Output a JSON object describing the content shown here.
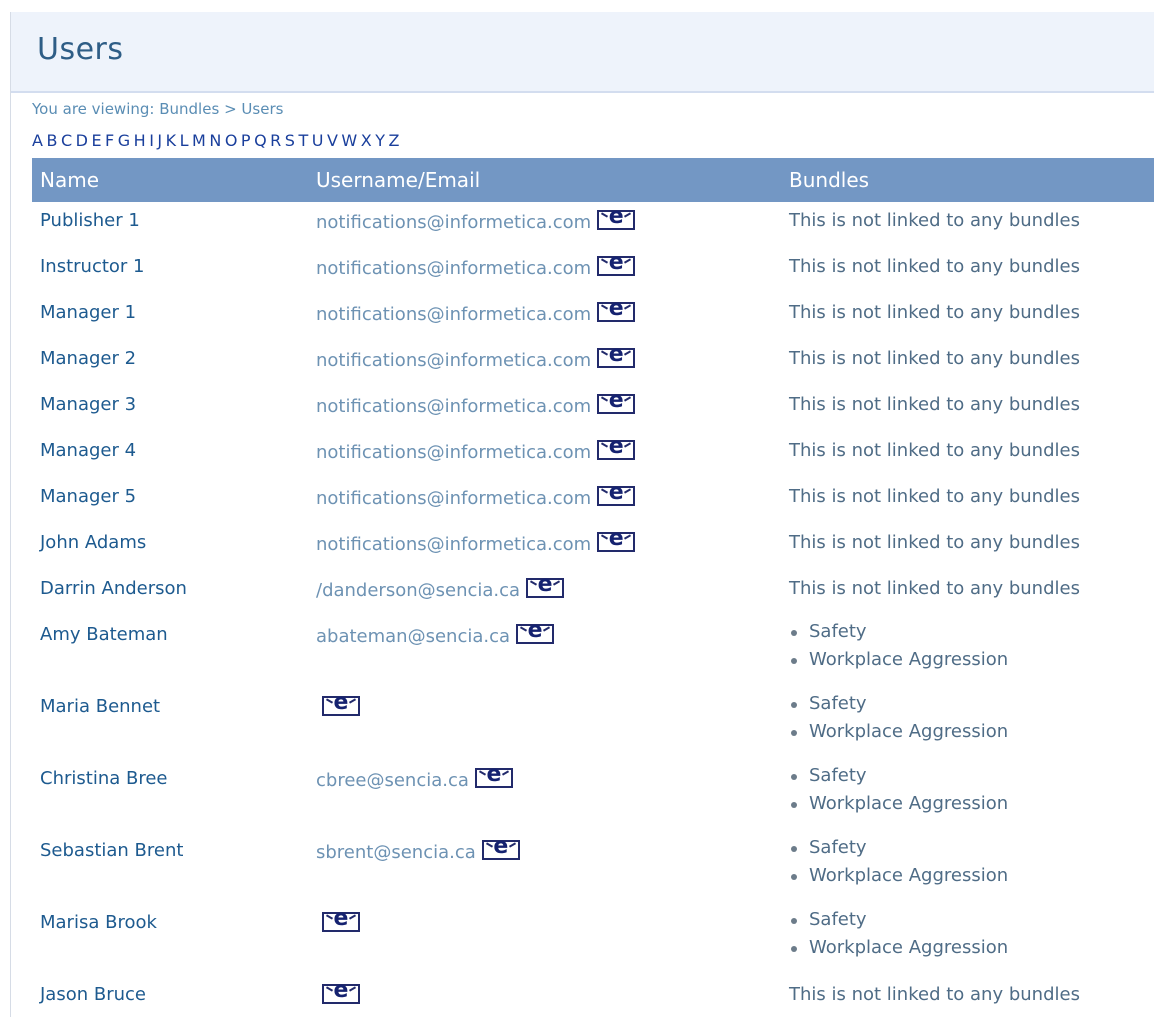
{
  "header": {
    "title": "Users"
  },
  "breadcrumb": {
    "prefix": "You are viewing:",
    "items": [
      "Bundles",
      "Users"
    ],
    "separator": ">"
  },
  "alphabet": [
    "A",
    "B",
    "C",
    "D",
    "E",
    "F",
    "G",
    "H",
    "I",
    "J",
    "K",
    "L",
    "M",
    "N",
    "O",
    "P",
    "Q",
    "R",
    "S",
    "T",
    "U",
    "V",
    "W",
    "X",
    "Y",
    "Z"
  ],
  "table": {
    "columns": [
      "Name",
      "Username/Email",
      "Bundles"
    ],
    "email_icon_glyph": "e",
    "rows": [
      {
        "name": "Publisher 1",
        "email": "notifications@informetica.com",
        "bundles_text": "This is not linked to any bundles"
      },
      {
        "name": "Instructor 1",
        "email": "notifications@informetica.com",
        "bundles_text": "This is not linked to any bundles"
      },
      {
        "name": "Manager 1",
        "email": "notifications@informetica.com",
        "bundles_text": "This is not linked to any bundles"
      },
      {
        "name": "Manager 2",
        "email": "notifications@informetica.com",
        "bundles_text": "This is not linked to any bundles"
      },
      {
        "name": "Manager 3",
        "email": "notifications@informetica.com",
        "bundles_text": "This is not linked to any bundles"
      },
      {
        "name": "Manager 4",
        "email": "notifications@informetica.com",
        "bundles_text": "This is not linked to any bundles"
      },
      {
        "name": "Manager 5",
        "email": "notifications@informetica.com",
        "bundles_text": "This is not linked to any bundles"
      },
      {
        "name": "John Adams",
        "email": "notifications@informetica.com",
        "bundles_text": "This is not linked to any bundles"
      },
      {
        "name": "Darrin Anderson",
        "email": "/danderson@sencia.ca",
        "bundles_text": "This is not linked to any bundles"
      },
      {
        "name": "Amy Bateman",
        "email": "abateman@sencia.ca",
        "bundles": [
          "Safety",
          "Workplace Aggression"
        ]
      },
      {
        "name": "Maria Bennet",
        "email": "",
        "bundles": [
          "Safety",
          "Workplace Aggression"
        ]
      },
      {
        "name": "Christina Bree",
        "email": "cbree@sencia.ca",
        "bundles": [
          "Safety",
          "Workplace Aggression"
        ]
      },
      {
        "name": "Sebastian Brent",
        "email": "sbrent@sencia.ca",
        "bundles": [
          "Safety",
          "Workplace Aggression"
        ]
      },
      {
        "name": "Marisa Brook",
        "email": "",
        "bundles": [
          "Safety",
          "Workplace Aggression"
        ]
      },
      {
        "name": "Jason Bruce",
        "email": "",
        "bundles_text": "This is not linked to any bundles"
      }
    ]
  }
}
